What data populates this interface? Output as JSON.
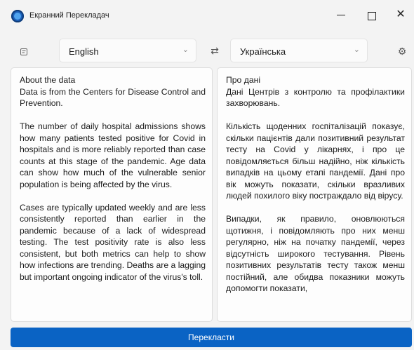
{
  "window": {
    "title": "Екранний Перекладач",
    "icon": "app-globe-icon",
    "controls": {
      "minimize": "minimize-icon",
      "maximize": "maximize-icon",
      "close": "✕"
    }
  },
  "toolbar": {
    "source_language": "English",
    "target_language": "Українська",
    "icons": [
      "document-icon",
      "swap-icon",
      "settings-gear-icon",
      "chevron-down-icon"
    ]
  },
  "source_text": "About the data\nData is from the Centers for Disease Control and Prevention.\n\nThe number of daily hospital admissions shows how many patients tested positive for Covid in hospitals and is more reliably reported than case counts at this stage of the pandemic. Age data can show how much of the vulnerable senior population is being affected by the virus.\n\nCases are typically updated weekly and are less consistently reported than earlier in the pandemic because of a lack of widespread testing. The test positivity rate is also less consistent, but both metrics can help to show how infections are trending. Deaths are a lagging but important ongoing indicator of the virus's toll.",
  "translated_text": "Про дані\nДані Центрів з контролю та профілактики захворювань.\n\nКількість щоденних госпіталізацій показує, скільки пацієнтів дали позитивний результат тесту на Covid у лікарнях, і про це повідомляється більш надійно, ніж кількість випадків на цьому етапі пандемії. Дані про вік можуть показати, скільки вразливих людей похилого віку постраждало від вірусу.\n\nВипадки, як правило, оновлюються щотижня, і повідомляють про них менш регулярно, ніж на початку пандемії, через відсутність широкого тестування. Рівень позитивних результатів тесту також менш постійний, але обидва показники можуть допомогти показати,",
  "actions": {
    "translate_label": "Перекласти"
  },
  "colors": {
    "accent": "#0a63c4",
    "background": "#f3f3f3",
    "panel": "#fdfdfd"
  }
}
